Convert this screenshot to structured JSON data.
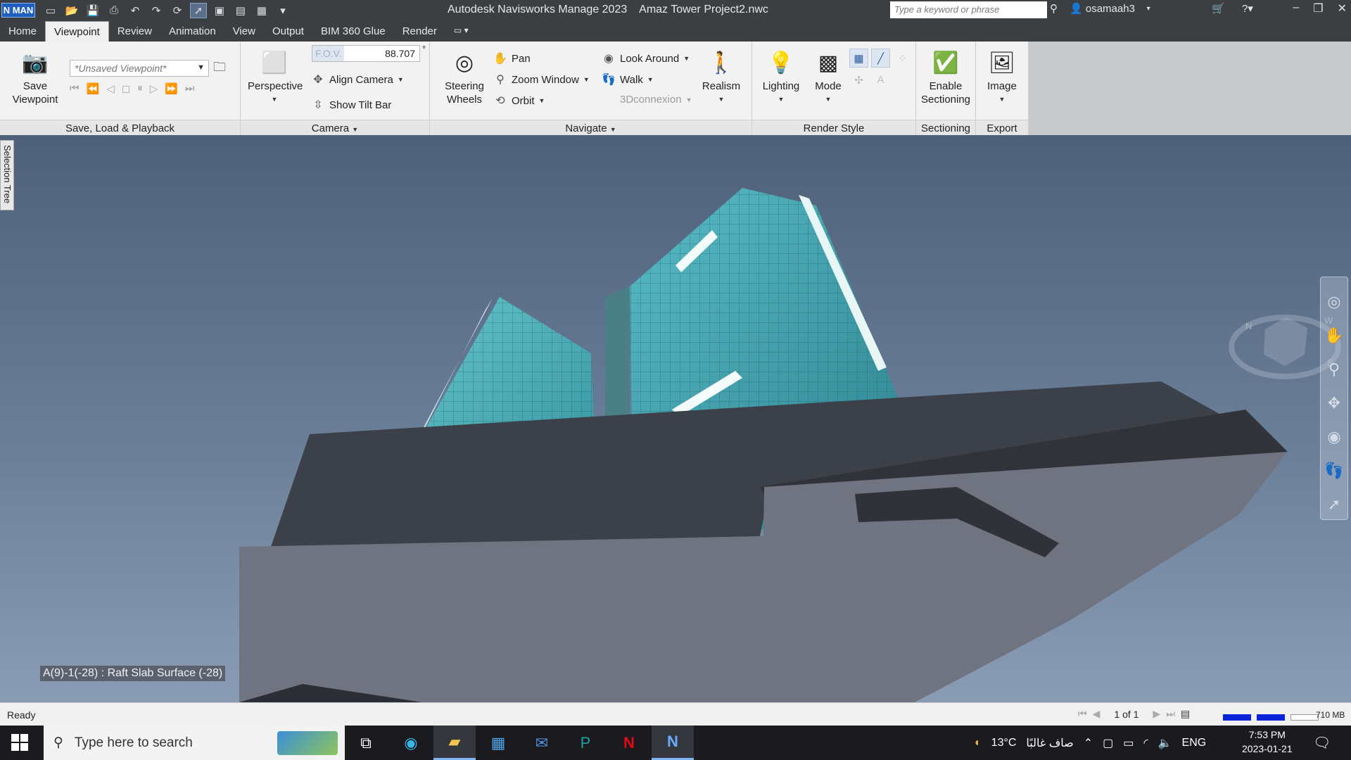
{
  "titlebar": {
    "logo_text": "N MAN",
    "title": "Autodesk Navisworks Manage 2023    Amaz Tower Project2.nwc",
    "search_placeholder": "Type a keyword or phrase",
    "user": "osamaah3"
  },
  "tabs": [
    "Home",
    "Viewpoint",
    "Review",
    "Animation",
    "View",
    "Output",
    "BIM 360 Glue",
    "Render"
  ],
  "active_tab": "Viewpoint",
  "ribbon": {
    "save_viewpoint": "Save\nViewpoint",
    "viewpoint_select": "*Unsaved Viewpoint*",
    "panel_save_load": "Save, Load & Playback",
    "perspective": "Perspective",
    "fov_label": "F.O.V.",
    "fov_value": "88.707",
    "fov_unit": "°",
    "align_camera": "Align Camera",
    "show_tilt_bar": "Show Tilt Bar",
    "panel_camera": "Camera",
    "steering_wheels": "Steering\nWheels",
    "pan": "Pan",
    "zoom_window": "Zoom Window",
    "orbit": "Orbit",
    "look_around": "Look Around",
    "walk": "Walk",
    "threedconnexion": "3Dconnexion",
    "realism": "Realism",
    "panel_navigate": "Navigate",
    "lighting": "Lighting",
    "mode": "Mode",
    "panel_render_style": "Render Style",
    "enable_sectioning": "Enable\nSectioning",
    "panel_sectioning": "Sectioning",
    "image": "Image",
    "panel_export": "Export"
  },
  "viewport": {
    "side_tab": "Selection Tree",
    "tooltip": "A(9)-1(-28) : Raft Slab Surface (-28)"
  },
  "statusbar": {
    "ready": "Ready",
    "page_count": "1 of 1",
    "memory": "710 MB"
  },
  "taskbar": {
    "search_placeholder": "Type here to search",
    "weather_temp": "13°C",
    "weather_text": "صاف غالبًا",
    "language": "ENG",
    "time": "7:53 PM",
    "date": "2023-01-21"
  },
  "colors": {
    "glass": "#3fa7b2",
    "slab": "#3b3f46",
    "sky_top": "#4e607a",
    "accent_blue": "#0a24d8"
  }
}
